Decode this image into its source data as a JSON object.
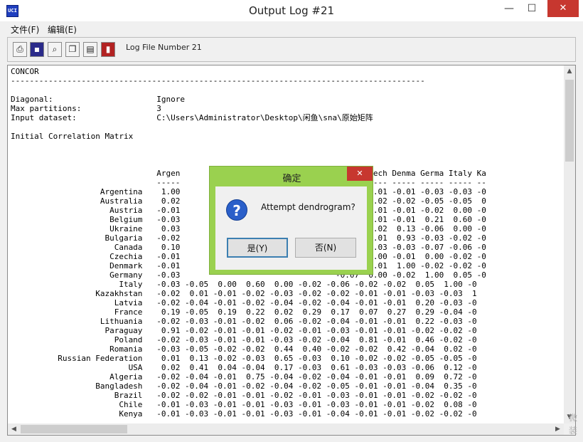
{
  "window": {
    "title": "Output Log #21",
    "app_icon": "UCI",
    "controls": {
      "minimize": "—",
      "maximize": "☐",
      "close": "✕"
    }
  },
  "menu": [
    "文件(F)",
    "编辑(E)"
  ],
  "toolbar": {
    "buttons": [
      "print-icon",
      "save-icon",
      "find-icon",
      "copy-icon",
      "paste-icon",
      "exit-icon"
    ],
    "log_label": "Log File Number 21"
  },
  "output": {
    "text": "CONCOR\n----------------------------------------------------------------------------------------\n\nDiagonal:                      Ignore\nMax partitions:                3\nInput dataset:                 C:\\Users\\Administrator\\Desktop\\闲鱼\\sna\\原始矩阵\n\nInitial Correlation Matrix\n\n\n\n                               Argen                                 Canad Czech Denma Germa Italy Ka\n                               -----                                 ----- ----- ----- ----- ----- --\n                   Argentina    1.00                                  0.10 -0.01 -0.01 -0.03 -0.03 -0\n                   Australia    0.02                                  0.40 -0.02 -0.02 -0.05 -0.05  0\n                     Austria   -0.01                                  0.11 -0.01 -0.01 -0.02  0.00 -0\n                     Belgium   -0.03                                 -0.04 -0.01 -0.01  0.21  0.60 -0\n                     Ukraine    0.03                                  0.23 -0.02  0.13 -0.06  0.00 -0\n                    Bulgaria   -0.02                                 -0.01 -0.01  0.93 -0.03 -0.02 -0\n                      Canada    0.10                                  1.00 -0.03 -0.03 -0.07 -0.06 -0\n                     Czechia   -0.01                                 -0.03  1.00 -0.01  0.00 -0.02 -0\n                     Denmark   -0.01                                 -0.03 -0.01  1.00 -0.02 -0.02 -0\n                     Germany   -0.03                                 -0.07  0.00 -0.02  1.00  0.05 -0\n                       Italy   -0.03 -0.05  0.00  0.60  0.00 -0.02 -0.06 -0.02 -0.02  0.05  1.00 -0\n                  Kazakhstan   -0.02  0.01 -0.01 -0.02 -0.03 -0.02 -0.02 -0.01 -0.01 -0.03 -0.03  1\n                      Latvia   -0.02 -0.04 -0.01 -0.02 -0.04 -0.02 -0.04 -0.01 -0.01  0.20 -0.03 -0\n                      France    0.19 -0.05  0.19  0.22  0.02  0.29  0.17  0.07  0.27  0.29 -0.04 -0\n                   Lithuania   -0.02 -0.03 -0.01 -0.02  0.06 -0.02 -0.04 -0.01 -0.01  0.22 -0.03 -0\n                    Paraguay    0.91 -0.02 -0.01 -0.01 -0.02 -0.01 -0.03 -0.01 -0.01 -0.02 -0.02 -0\n                      Poland   -0.02 -0.03 -0.01 -0.01 -0.03 -0.02 -0.04  0.81 -0.01  0.46 -0.02 -0\n                     Romania   -0.03 -0.05 -0.02 -0.02  0.44  0.40 -0.02 -0.02  0.42 -0.04  0.02 -0\n          Russian Federation    0.01  0.13 -0.02 -0.03  0.65 -0.03  0.10 -0.02 -0.02 -0.05 -0.05 -0\n                         USA    0.02  0.41  0.04 -0.04  0.17 -0.03  0.61 -0.03 -0.03 -0.06  0.12 -0\n                     Algeria   -0.02 -0.04 -0.01  0.75 -0.04 -0.02 -0.04 -0.01 -0.01  0.09  0.72 -0\n                  Bangladesh   -0.02 -0.04 -0.01 -0.02 -0.04 -0.02 -0.05 -0.01 -0.01 -0.04  0.35 -0\n                      Brazil   -0.02 -0.02 -0.01 -0.01 -0.02 -0.01 -0.03 -0.01 -0.01 -0.02 -0.02 -0\n                       Chile   -0.01 -0.03 -0.01 -0.01 -0.03 -0.01 -0.03 -0.01 -0.01 -0.02  0.08 -0\n                       Kenya   -0.01 -0.03 -0.01 -0.01 -0.03 -0.01 -0.04 -0.01 -0.01 -0.02 -0.02 -0"
  },
  "dialog": {
    "title": "确定",
    "message": "Attempt dendrogram?",
    "yes_label": "是(Y)",
    "no_label": "否(N)"
  },
  "watermark": "微 装"
}
